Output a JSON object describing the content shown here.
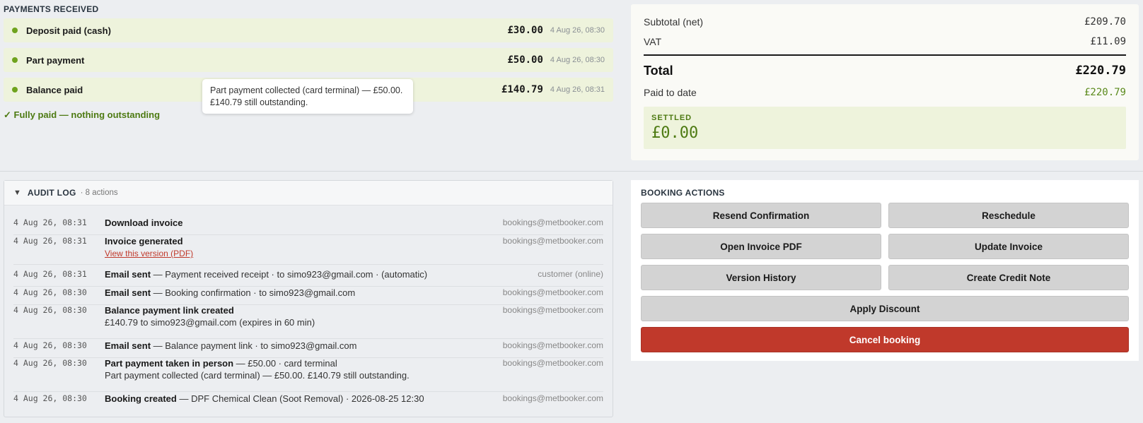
{
  "payments": {
    "section_label": "PAYMENTS RECEIVED",
    "rows": [
      {
        "label": "Deposit paid (cash)",
        "amount": "£30.00",
        "time": "4 Aug 26, 08:30"
      },
      {
        "label": "Part payment",
        "amount": "£50.00",
        "time": "4 Aug 26, 08:30"
      },
      {
        "label": "Balance paid",
        "amount": "£140.79",
        "time": "4 Aug 26, 08:31"
      }
    ],
    "status": "✓ Fully paid — nothing outstanding",
    "tooltip": "Part payment collected (card terminal) — £50.00. £140.79 still outstanding."
  },
  "totals": {
    "subtotal_label": "Subtotal (net)",
    "subtotal_value": "£209.70",
    "vat_label": "VAT",
    "vat_value": "£11.09",
    "total_label": "Total",
    "total_value": "£220.79",
    "paid_label": "Paid to date",
    "paid_value": "£220.79",
    "settled_label": "SETTLED",
    "settled_value": "£0.00"
  },
  "audit": {
    "title": "AUDIT LOG",
    "count": "· 8 actions",
    "rows": [
      {
        "time": "4 Aug 26, 08:31",
        "action": "Download invoice",
        "detail": "",
        "extra": "",
        "link": "",
        "user": "bookings@metbooker.com"
      },
      {
        "time": "4 Aug 26, 08:31",
        "action": "Invoice generated",
        "detail": "",
        "extra": "",
        "link": "View this version (PDF)",
        "user": "bookings@metbooker.com"
      },
      {
        "time": "4 Aug 26, 08:31",
        "action": "Email sent",
        "detail": " — Payment received receipt · to simo923@gmail.com · (automatic)",
        "extra": "",
        "link": "",
        "user": "customer (online)"
      },
      {
        "time": "4 Aug 26, 08:30",
        "action": "Email sent",
        "detail": " — Booking confirmation · to simo923@gmail.com",
        "extra": "",
        "link": "",
        "user": "bookings@metbooker.com"
      },
      {
        "time": "4 Aug 26, 08:30",
        "action": "Balance payment link created",
        "detail": "",
        "extra": "£140.79 to simo923@gmail.com (expires in 60 min)",
        "link": "",
        "user": "bookings@metbooker.com"
      },
      {
        "time": "4 Aug 26, 08:30",
        "action": "Email sent",
        "detail": " — Balance payment link · to simo923@gmail.com",
        "extra": "",
        "link": "",
        "user": "bookings@metbooker.com"
      },
      {
        "time": "4 Aug 26, 08:30",
        "action": "Part payment taken in person",
        "detail": " — £50.00 · card terminal",
        "extra": "Part payment collected (card terminal) — £50.00. £140.79 still outstanding.",
        "link": "",
        "user": "bookings@metbooker.com"
      },
      {
        "time": "4 Aug 26, 08:30",
        "action": "Booking created",
        "detail": " — DPF Chemical Clean (Soot Removal) · 2026-08-25 12:30",
        "extra": "",
        "link": "",
        "user": "bookings@metbooker.com"
      }
    ]
  },
  "actions": {
    "section_label": "BOOKING ACTIONS",
    "resend": "Resend Confirmation",
    "reschedule": "Reschedule",
    "open_pdf": "Open Invoice PDF",
    "update_invoice": "Update Invoice",
    "version_history": "Version History",
    "credit_note": "Create Credit Note",
    "apply_discount": "Apply Discount",
    "cancel": "Cancel booking"
  },
  "colors": {
    "accent_green": "#6fa31d",
    "danger": "#c0392b",
    "settled_bg": "#eef3dc"
  }
}
